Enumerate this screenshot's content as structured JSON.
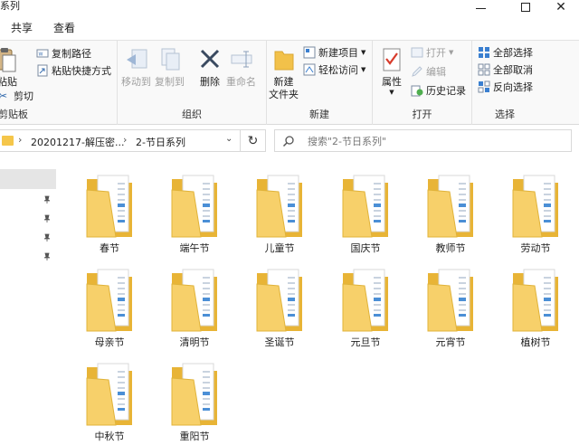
{
  "window": {
    "title": "系列"
  },
  "tabs": [
    {
      "label": "共享"
    },
    {
      "label": "查看"
    }
  ],
  "ribbon": {
    "clipboard": {
      "label": "剪贴板",
      "paste": "粘贴",
      "cut": "剪切",
      "copy_path": "复制路径",
      "paste_shortcut": "粘贴快捷方式"
    },
    "organize": {
      "label": "组织",
      "move_to": "移动到",
      "copy_to": "复制到",
      "delete": "删除",
      "rename": "重命名"
    },
    "new": {
      "label": "新建",
      "new_folder": "新建\n文件夹",
      "new_item": "新建项目",
      "easy_access": "轻松访问"
    },
    "open": {
      "label": "打开",
      "properties": "属性",
      "open": "打开",
      "edit": "编辑",
      "history": "历史记录"
    },
    "select": {
      "label": "选择",
      "select_all": "全部选择",
      "select_none": "全部取消",
      "invert": "反向选择"
    }
  },
  "address": {
    "crumbs": [
      "20201217-解压密...",
      "2-节日系列"
    ],
    "search_placeholder": "搜索\"2-节日系列\""
  },
  "folders": [
    "春节",
    "端午节",
    "儿童节",
    "国庆节",
    "教师节",
    "劳动节",
    "母亲节",
    "清明节",
    "圣诞节",
    "元旦节",
    "元宵节",
    "植树节",
    "中秋节",
    "重阳节"
  ],
  "colors": {
    "folder": "#f5c64a",
    "folder_back": "#e8b436",
    "accent": "#0078d7"
  }
}
